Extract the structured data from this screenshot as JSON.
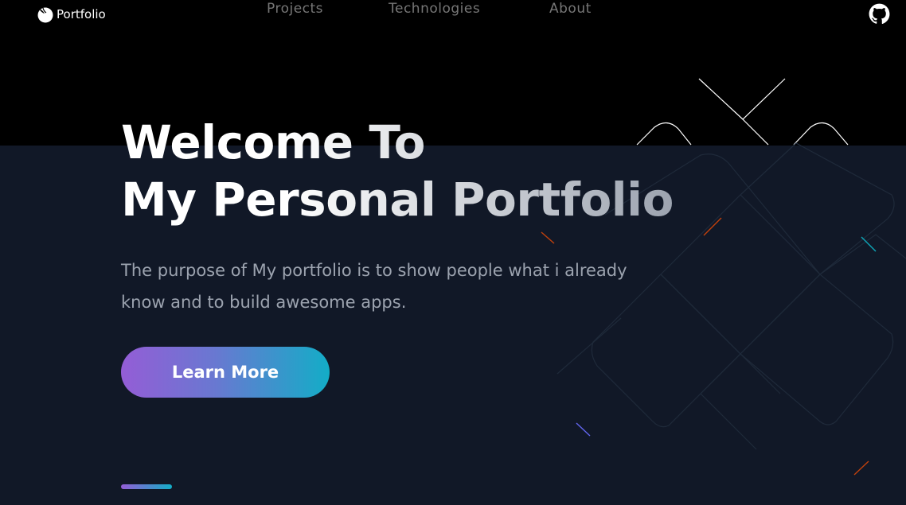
{
  "header": {
    "brand": "Portfolio",
    "nav": [
      "Projects",
      "Technologies",
      "About"
    ],
    "github_icon": "github-icon",
    "brand_icon": "portfolio-logo-icon"
  },
  "hero": {
    "title_line1": "Welcome To",
    "title_line2": "My Personal Portfolio",
    "description": "The purpose of My portfolio is to show people what i already know and to build awesome apps.",
    "cta_label": "Learn More"
  },
  "colors": {
    "page_bg": "#111827",
    "top_band": "#000000",
    "accent_start": "#945dd6",
    "accent_end": "#13adc7",
    "muted_text": "#9ca3af"
  }
}
